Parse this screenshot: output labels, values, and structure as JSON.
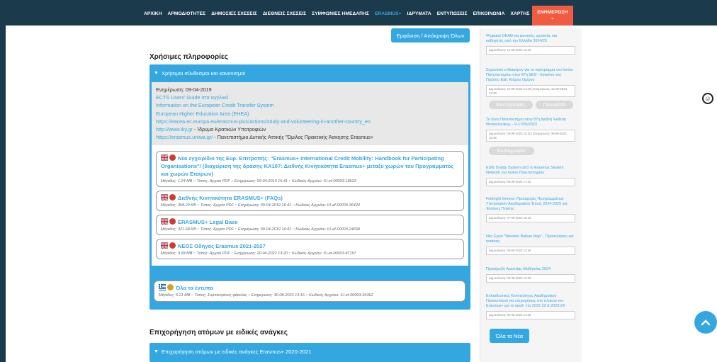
{
  "nav": {
    "items": [
      "ΑΡΧΙΚΗ",
      "ΑΡΜΟΔΙΟΤΗΤΕΣ",
      "ΔΗΜΟΣΙΕΣ ΣΧΕΣΕΙΣ",
      "ΔΙΕΘΝΕΙΣ ΣΧΕΣΕΙΣ",
      "ΣΥΜΦΩΝΙΕΣ ΗΜΕΔΑΠΗΣ",
      "ERASMUS+",
      "ΙΔΡΥΜΑΤΑ",
      "ΕΝΤΥΠΩΣΕΙΣ",
      "ΕΠΙΚΟΙΝΩΝΙΑ",
      "ΧΑΡΤΗΣ"
    ],
    "news_label": "ΕΝΗΜΕΡΩΣΗ",
    "active_index": 5
  },
  "expand_button": "Εμφάνιση / Απόκρυψη Όλων",
  "section1": {
    "title": "Χρήσιμες πληροφορίες",
    "accordion_title": "Χρήσιμοι σύνδεσμοι και κανονισμοί",
    "info": {
      "updated": "Ενημέρωση: 09-04-2019",
      "links": [
        "ECTS Users' Guide στα αγγλικά",
        "Information on the European Credit Transfer System",
        "European Higher Education Area (EHEA)",
        "https://eacea.ec.europa.eu/erasmus-plus/actions/study-and-volunteering-in-another-country_en"
      ],
      "line_iky_link": "http://www.iky.gr",
      "line_iky_text": " - Ίδρυμα Κρατικών Υποτροφιών",
      "line_uniwa_link": "https://erasmus.uniwa.gr/",
      "line_uniwa_text": " - Πανεπιστήμιο Δυτικής Αττικής \"Όμιλος Πρακτικής Άσκησης Erasmus+"
    },
    "files": [
      {
        "title": "Νέο εγχειρίδιο της Ευρ. Επιτροπής: \"Erasmus+ International Credit Mobility: Handbook for Participating Organisations\"/ (διαχείριση της δράσης ΚΑ107: Διεθνής Κινητικότητα Erasmus+ μεταξύ χωρών του Προγράμματος και χωρών Εταίρων)",
        "meta": "Μέγεθος: 1.24 MB :: Τύπος: Αρχείο PDF :: Ενημέρωση: 09-04-2019 16:41 :: Κωδικός Αρχείου: IU-ef-00003-18623"
      },
      {
        "title": "Διεθνής Κινητικότητα ERASMUS+ (FAQs)",
        "meta": "Μέγεθος: 368.29 KB :: Τύπος: Αρχείο PDF :: Ενημέρωση: 09-04-2019 16:41 :: Κωδικός Αρχείου: IU-ef-00003-36424"
      },
      {
        "title": "ERASMUS+ Legal Base",
        "meta": "Μέγεθος: 321.68 KB :: Τύπος: Αρχείο PDF :: Ενημέρωση: 09-04-2019 16:41 :: Κωδικός Αρχείου: IU-ef-00003-24658"
      },
      {
        "title": "ΝΕΟΣ Οδηγός Erasmus 2021-2027",
        "meta": "Μέγεθος: 3.68 MB :: Τύπος: Αρχείο PDF :: Ενημέρωση: 20-04-2022 13:20 :: Κωδικός Αρχείου: IU-ef-00003-87197"
      }
    ],
    "all_files": {
      "title": "Όλα τα έντυπα",
      "meta": "Μέγεθος: 5.21 MB :: Τύπος: Συμπιεσμένος φάκελος :: Ενημέρωση: 30-08-2023 13:16 :: Κωδικός Αρχείου: IU-ef-00003-94362"
    }
  },
  "section2": {
    "title": "Επιχορήγηση ατόμων με ειδικές ανάγκες",
    "accordion_title": "Επιχορήγηση ατόμων με ειδικές ανάγκες Erasmus+ 2020-2021"
  },
  "sidebar": {
    "news": [
      {
        "title": "Ψηφιακό ΟΚΑΘ για φοιτητές: εργασίες και καθηγητές από την Ελλάδα 2024/25",
        "date": "Δημοσίευση: 12-09-2023 12:40"
      },
      {
        "title": "Σημαντικό ενδιαφέρον για το πρόγραμμα του Ιονίου Πανεπιστημίου στην 87η ΔΕΘ - Εγκαίνια του Πρώτου Eall. Κιάρου Ομίρου",
        "date": "Δημοσίευση: 10-09-2023 14:49 | Ενημέρωση: 12-09-2023 12:39"
      },
      {
        "title": "Το Ιόνιο Πανεπιστήμιο στην 87η Διεθνή Έκθεση Θεσσαλονίκης – 9-17/09/2023",
        "date": "Δημοσίευση: 08-09-2023 10:11 | Ενημέρωση: 09-09-2023 12:49"
      },
      {
        "title": "ESN: Buddy System από το Erasmus Student Network του Ιονίου Πανεπιστημίου",
        "date": "Δημοσίευση: 08-09-2023 17:22"
      },
      {
        "title": "Fulbright Greece: Προσφορές Προγραμμάτων Υποτροφιών Ακαδημαϊκού Έτους 2024-2025 για Έλληνες Πολίτες",
        "date": "Δημοσίευση: 07-09-2023 18:15"
      },
      {
        "title": "Νέο Έργο \"Western Balkan Map\" - Προσκλήσεις για εκτάσεις",
        "date": "Δημοσίευση: 06-09-2023 13:36"
      },
      {
        "title": "Προκήρυξη Αριστείας Μαθητείας 2024",
        "date": "Δημοσίευση: 05-09-2023 12:20"
      },
      {
        "title": "Εκπαιδευτικές Κινητικότητες Ακαδημαϊκού Προσωπικού για επιχειρήσεις στο πλαίσιο του Erasmus+ για το ακαδ. έτη 2022-23 & 2023-24",
        "date": "Δημοσίευση: 30-05-2023 14:28"
      }
    ],
    "pill_photos": "Φωτογραφίες",
    "pill_media": "Πολυμέσα",
    "all_news": "Όλα τα Νέα"
  },
  "colors": {
    "accent": "#35a7e0",
    "nav_bg": "#1b3a4b",
    "news_tab": "#f15b41"
  }
}
